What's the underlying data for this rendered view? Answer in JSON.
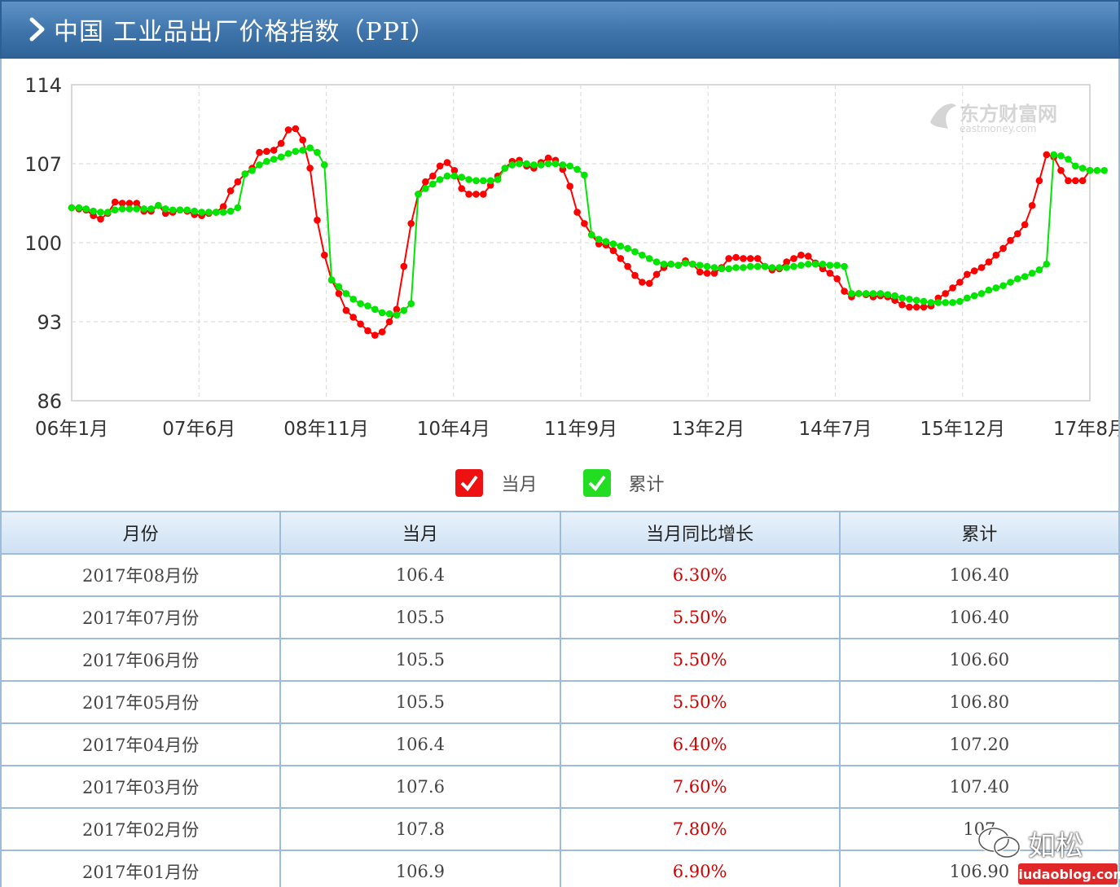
{
  "header": {
    "title": "中国  工业品出厂价格指数（PPI）"
  },
  "chart_data": {
    "type": "line",
    "title": "",
    "xlabel": "",
    "ylabel": "",
    "ylim": [
      86,
      114
    ],
    "yticks": [
      86,
      93,
      100,
      107,
      114
    ],
    "xtick_labels": [
      "06年1月",
      "07年6月",
      "08年11月",
      "10年4月",
      "11年9月",
      "13年2月",
      "14年7月",
      "15年12月",
      "17年8月"
    ],
    "grid": true,
    "legend": "bottom-center",
    "watermark": {
      "cn": "东方财富网",
      "en": "eastmoney.com"
    },
    "colors": {
      "当月": "#ff0000",
      "累计": "#00e600"
    },
    "series": [
      {
        "name": "当月",
        "values": [
          103.1,
          103.0,
          102.9,
          102.4,
          102.1,
          102.6,
          103.6,
          103.5,
          103.5,
          103.5,
          102.8,
          102.8,
          103.3,
          102.6,
          102.7,
          102.9,
          102.8,
          102.5,
          102.4,
          102.6,
          102.7,
          103.2,
          104.6,
          105.4,
          106.1,
          106.6,
          108.0,
          108.1,
          108.2,
          108.8,
          110.0,
          110.1,
          109.1,
          106.6,
          102.0,
          98.9,
          96.7,
          95.5,
          94.0,
          93.4,
          92.8,
          92.2,
          91.8,
          92.1,
          93.0,
          94.1,
          97.9,
          101.7,
          104.3,
          105.4,
          105.9,
          106.8,
          107.1,
          106.4,
          104.8,
          104.3,
          104.3,
          104.3,
          105.1,
          105.9,
          106.6,
          107.2,
          107.3,
          106.8,
          106.6,
          107.1,
          107.5,
          107.3,
          106.5,
          105.0,
          102.7,
          101.7,
          100.7,
          99.9,
          99.8,
          99.3,
          98.6,
          97.9,
          97.1,
          96.5,
          96.4,
          97.2,
          97.8,
          98.1,
          98.0,
          98.4,
          98.1,
          97.4,
          97.3,
          97.3,
          97.8,
          98.6,
          98.7,
          98.6,
          98.6,
          98.6,
          97.9,
          97.6,
          97.7,
          98.3,
          98.6,
          98.9,
          98.8,
          98.2,
          97.7,
          97.3,
          96.8,
          95.7,
          95.2,
          95.5,
          95.4,
          95.2,
          95.3,
          95.2,
          94.9,
          94.5,
          94.3,
          94.3,
          94.3,
          94.4,
          95.1,
          95.5,
          96.0,
          96.5,
          97.2,
          97.5,
          97.8,
          98.3,
          98.9,
          99.5,
          100.2,
          100.8,
          101.6,
          103.3,
          105.5,
          107.8,
          107.6,
          106.4,
          105.5,
          105.5,
          105.5,
          106.4
        ]
      },
      {
        "name": "累计",
        "values": [
          103.1,
          103.1,
          103.0,
          102.8,
          102.7,
          102.7,
          102.9,
          103.0,
          103.0,
          103.0,
          103.0,
          103.0,
          103.3,
          103.0,
          102.9,
          102.9,
          102.9,
          102.8,
          102.7,
          102.7,
          102.7,
          102.7,
          102.8,
          103.1,
          106.1,
          106.4,
          106.9,
          107.2,
          107.4,
          107.6,
          107.9,
          108.1,
          108.2,
          108.4,
          108.0,
          106.9,
          96.7,
          96.1,
          95.5,
          95.0,
          94.6,
          94.4,
          94.1,
          93.8,
          93.7,
          93.6,
          94.0,
          94.6,
          104.3,
          104.8,
          105.2,
          105.6,
          105.9,
          105.9,
          105.8,
          105.6,
          105.5,
          105.5,
          105.5,
          105.6,
          106.6,
          106.9,
          107.0,
          107.0,
          106.9,
          106.9,
          107.0,
          107.0,
          106.9,
          106.8,
          106.5,
          106.0,
          100.7,
          100.3,
          100.1,
          99.9,
          99.7,
          99.5,
          99.2,
          98.9,
          98.6,
          98.3,
          98.1,
          98.1,
          98.0,
          98.2,
          98.1,
          98.0,
          97.9,
          97.8,
          97.7,
          97.7,
          97.8,
          97.8,
          97.9,
          97.9,
          97.9,
          97.8,
          97.8,
          97.8,
          97.9,
          98.0,
          98.1,
          98.1,
          98.1,
          98.0,
          98.0,
          97.9,
          95.5,
          95.5,
          95.5,
          95.5,
          95.5,
          95.4,
          95.3,
          95.1,
          95.0,
          94.9,
          94.8,
          94.7,
          94.7,
          94.7,
          94.7,
          94.8,
          95.1,
          95.3,
          95.5,
          95.8,
          96.0,
          96.2,
          96.5,
          96.8,
          97.0,
          97.3,
          97.6,
          98.1,
          107.8,
          107.7,
          107.4,
          106.8,
          106.6,
          106.4,
          106.4,
          106.4
        ]
      }
    ]
  },
  "legend": {
    "items": [
      "当月",
      "累计"
    ]
  },
  "table": {
    "headers": [
      "月份",
      "当月",
      "当月同比增长",
      "累计"
    ],
    "rows": [
      [
        "2017年08月份",
        "106.4",
        "6.30%",
        "106.40"
      ],
      [
        "2017年07月份",
        "105.5",
        "5.50%",
        "106.40"
      ],
      [
        "2017年06月份",
        "105.5",
        "5.50%",
        "106.60"
      ],
      [
        "2017年05月份",
        "105.5",
        "5.50%",
        "106.80"
      ],
      [
        "2017年04月份",
        "106.4",
        "6.40%",
        "107.20"
      ],
      [
        "2017年03月份",
        "107.6",
        "7.60%",
        "107.40"
      ],
      [
        "2017年02月份",
        "107.8",
        "7.80%",
        "107"
      ],
      [
        "2017年01月份",
        "106.9",
        "6.90%",
        "106.90"
      ]
    ]
  },
  "watermark": {
    "text": "如松",
    "url": "niudaoblog.com"
  }
}
